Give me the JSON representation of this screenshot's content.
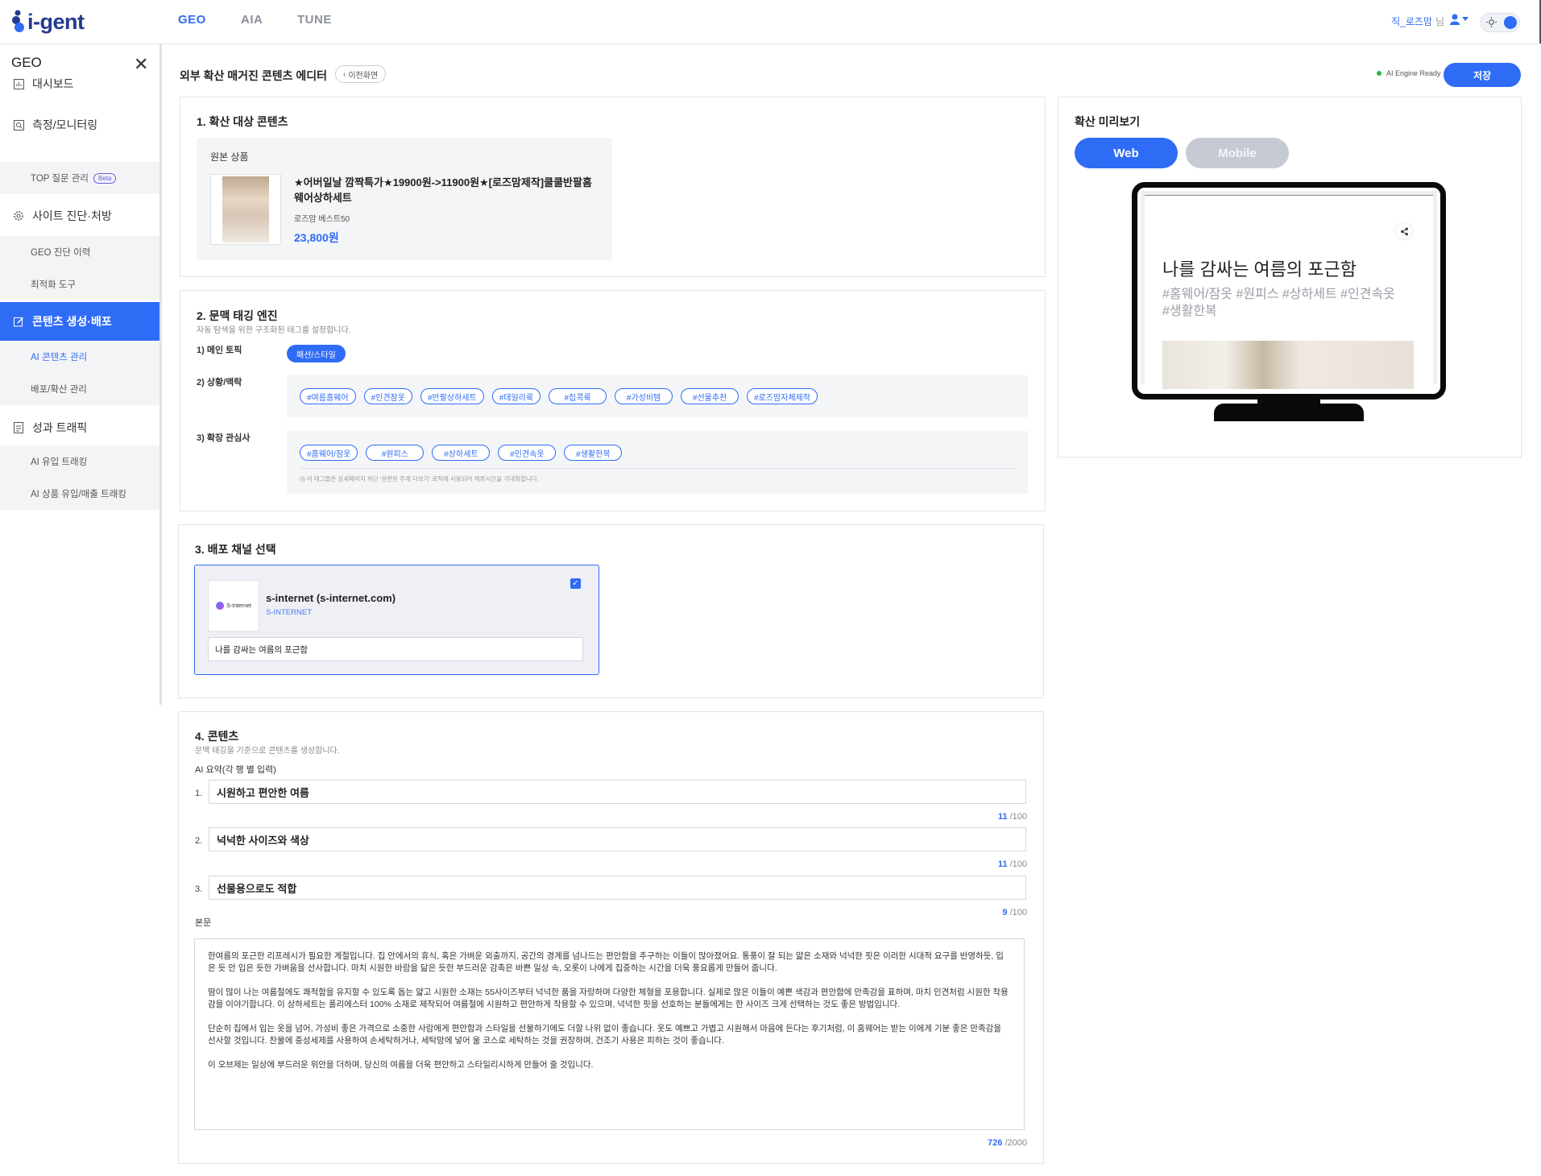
{
  "app": {
    "logo": "i-gent",
    "nav": [
      "GEO",
      "AIA",
      "TUNE"
    ],
    "user_name": "직_로즈맘",
    "user_suffix": "님"
  },
  "sidebar": {
    "title": "GEO",
    "items": [
      {
        "label": "대시보드",
        "icon": "dashboard-icon"
      },
      {
        "label": "측정/모니터링",
        "icon": "monitor-icon"
      },
      {
        "label": "TOP 질문 관리",
        "sub": true,
        "badge": "Beta"
      },
      {
        "label": "사이트 진단·처방",
        "icon": "gear-icon"
      },
      {
        "label": "GEO 진단 이력",
        "sub": true
      },
      {
        "label": "최적화 도구",
        "sub": true
      },
      {
        "label": "콘텐츠 생성·배포",
        "icon": "edit-icon",
        "active": true
      },
      {
        "label": "AI 콘텐츠 관리",
        "sub": true,
        "active": true
      },
      {
        "label": "배포/확산 관리",
        "sub": true
      },
      {
        "label": "성과 트래픽",
        "icon": "document-icon"
      },
      {
        "label": "AI 유입 트래킹",
        "sub": true
      },
      {
        "label": "AI 상품 유입/매출 트래킹",
        "sub": true
      }
    ]
  },
  "header": {
    "title": "외부 확산 매거진 콘텐츠 에디터",
    "back": "이전화면",
    "engine_status": "AI Engine Ready",
    "save": "저장"
  },
  "section1": {
    "title": "1. 확산 대상 콘텐츠",
    "box_label": "원본 상품",
    "product_name": "★어버일날 깜짝특가★19900원->11900원★[로즈맘제작]쿨쿨반팔홈웨어상하세트",
    "product_sub": "로즈맘 베스트50",
    "price": "23,800원"
  },
  "section2": {
    "title": "2. 문맥 태깅 엔진",
    "subtitle": "자동 탐색을 위한 구조화된 태그를 설정합니다.",
    "main_topic_label": "1) 메인 토픽",
    "main_topic": "패션/스타일",
    "context_label": "2) 상황/맥락",
    "context_tags": [
      "#여름홈웨어",
      "#인견잠옷",
      "#반팔상하세트",
      "#데일리룩",
      "#집콕룩",
      "#가성비템",
      "#선물추천",
      "#로즈맘자체제작"
    ],
    "interest_label": "3) 확장 관심사",
    "interest_tags": [
      "#홈웨어/잠옷",
      "#원피스",
      "#상하세트",
      "#인견속옷",
      "#생활한복"
    ],
    "note": "(i) 이 태그들은 상세페이지 하단 '관련된 주제 더보기' 로직에 사용되어 체류시간을 극대화합니다."
  },
  "section3": {
    "title": "3. 배포 채널 선택",
    "channel_logo": "S-Internet",
    "channel_name": "s-internet (s-internet.com)",
    "channel_sub": "S-INTERNET",
    "channel_title": "나를 감싸는 여름의 포근함"
  },
  "section4": {
    "title": "4. 콘텐츠",
    "subtitle": "문맥 태깅을 기준으로 콘텐츠를 생성합니다.",
    "summary_label": "AI 요약(각 행 별 입력)",
    "summaries": [
      {
        "num": "1.",
        "text": "시원하고 편안한 여름",
        "count": "11",
        "max": "/100"
      },
      {
        "num": "2.",
        "text": "넉넉한 사이즈와 색상",
        "count": "11",
        "max": "/100"
      },
      {
        "num": "3.",
        "text": "선물용으로도 적합",
        "count": "9",
        "max": "/100"
      }
    ],
    "body_label": "본문",
    "body_paragraphs": [
      "한여름의 포근한 리프레시가 필요한 계절입니다. 집 안에서의 휴식, 혹은 가벼운 외출까지, 공간의 경계를 넘나드는 편안함을 추구하는 이들이 많아졌어요. 통풍이 잘 되는 얇은 소재와 넉넉한 핏은 이러한 시대적 요구를 반영하듯, 입은 듯 안 입은 듯한 가벼움을 선사합니다. 마치 시원한 바람을 닮은 듯한 부드러운 감촉은 바쁜 일상 속, 오롯이 나에게 집중하는 시간을 더욱 풍요롭게 만들어 줍니다.",
      "땀이 많이 나는 여름철에도 쾌적함을 유지할 수 있도록 돕는 얇고 시원한 소재는 55사이즈부터 넉넉한 품을 자랑하며 다양한 체형을 포용합니다. 실제로 많은 이들이 예쁜 색감과 편안함에 만족감을 표하며, 마치 인견처럼 시원한 착용감을 이야기합니다. 이 상하세트는 폴리에스터 100% 소재로 제작되어 여름철에 시원하고 편안하게 착용할 수 있으며, 넉넉한 핏을 선호하는 분들에게는 한 사이즈 크게 선택하는 것도 좋은 방법입니다.",
      "단순히 집에서 입는 옷을 넘어, 가성비 좋은 가격으로 소중한 사람에게 편안함과 스타일을 선물하기에도 더할 나위 없이 좋습니다. 옷도 예쁘고 가볍고 시원해서 마음에 든다는 후기처럼, 이 홈웨어는 받는 이에게 기분 좋은 만족감을 선사할 것입니다. 찬물에 중성세제를 사용하여 손세탁하거나, 세탁망에 넣어 울 코스로 세탁하는 것을 권장하며, 건조기 사용은 피하는 것이 좋습니다.",
      "이 오브제는 일상에 부드러운 위안을 더하며, 당신의 여름을 더욱 편안하고 스타일리시하게 만들어 줄 것입니다."
    ],
    "body_count": "726",
    "body_max": "/2000"
  },
  "preview": {
    "title": "확산 미리보기",
    "tabs": [
      "Web",
      "Mobile"
    ],
    "active_tab": "Web",
    "article_title": "나를 감싸는 여름의 포근함",
    "article_tags": "#홈웨어/잠옷 #원피스 #상하세트 #인견속옷 #생활한복"
  },
  "colors": {
    "accent": "#2f6cf6",
    "brand": "#233a8c",
    "status_ready": "#2eb84b"
  }
}
